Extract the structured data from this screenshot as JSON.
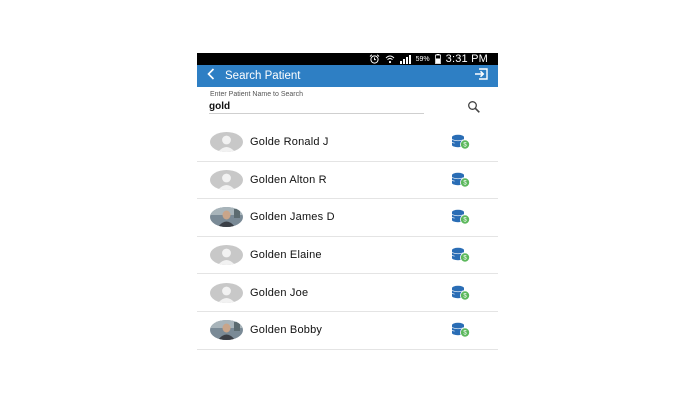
{
  "status_bar": {
    "battery_percent": "59%",
    "time": "3:31 PM",
    "icons": [
      "alarm-icon",
      "wifi-icon",
      "signal-icon",
      "battery-icon"
    ]
  },
  "app_bar": {
    "title": "Search Patient",
    "back_icon": "chevron-left-icon",
    "action_icon": "logout-icon"
  },
  "search": {
    "hint": "Enter Patient Name to Search",
    "value": "gold",
    "icon": "search-icon"
  },
  "patients": [
    {
      "name": "Golde Ronald J",
      "avatar": "placeholder"
    },
    {
      "name": "Golden Alton R",
      "avatar": "placeholder"
    },
    {
      "name": "Golden James D",
      "avatar": "photo"
    },
    {
      "name": "Golden Elaine",
      "avatar": "placeholder"
    },
    {
      "name": "Golden Joe",
      "avatar": "placeholder"
    },
    {
      "name": "Golden Bobby",
      "avatar": "photo"
    }
  ],
  "colors": {
    "app_bar": "#2e7fc4",
    "status_bar": "#000000",
    "coin_icon_blue": "#2a6db5",
    "coin_icon_green": "#5cb85c"
  }
}
